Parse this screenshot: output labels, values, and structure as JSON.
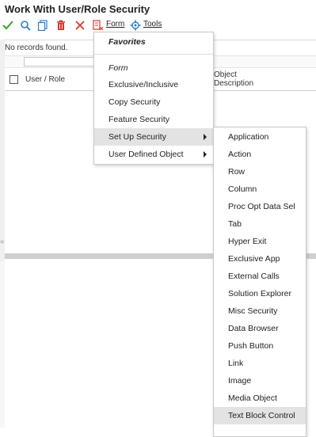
{
  "window": {
    "title": "Work With User/Role Security"
  },
  "toolbar": {
    "form_label": "Form",
    "tools_label": "Tools",
    "icons": [
      "checkmark-icon",
      "search-icon",
      "copy-icon",
      "delete-icon",
      "close-icon",
      "form-icon",
      "gear-icon"
    ],
    "colors": {
      "green": "#3aa02a",
      "blue": "#2a7bd0",
      "red": "#d23a2a"
    }
  },
  "grid": {
    "no_records": "No records found.",
    "columns": {
      "user_role": "User / Role",
      "object_description_line1": "Object",
      "object_description_line2": "Description"
    }
  },
  "form_menu": {
    "favorites": "Favorites",
    "form_section": "Form",
    "items": [
      {
        "label": "Exclusive/Inclusive"
      },
      {
        "label": "Copy Security"
      },
      {
        "label": "Feature Security"
      },
      {
        "label": "Set Up Security",
        "has_submenu": true,
        "highlighted": true
      },
      {
        "label": "User Defined Object",
        "has_submenu": true
      }
    ]
  },
  "setup_security_submenu": {
    "items": [
      {
        "label": "Application"
      },
      {
        "label": "Action"
      },
      {
        "label": "Row"
      },
      {
        "label": "Column"
      },
      {
        "label": "Proc Opt Data Sel"
      },
      {
        "label": "Tab"
      },
      {
        "label": "Hyper Exit"
      },
      {
        "label": "Exclusive App"
      },
      {
        "label": "External Calls"
      },
      {
        "label": "Solution Explorer"
      },
      {
        "label": "Misc Security"
      },
      {
        "label": "Data Browser"
      },
      {
        "label": "Push Button"
      },
      {
        "label": "Link"
      },
      {
        "label": "Image"
      },
      {
        "label": "Media Object"
      },
      {
        "label": "Text Block Control",
        "highlighted": true
      }
    ]
  }
}
